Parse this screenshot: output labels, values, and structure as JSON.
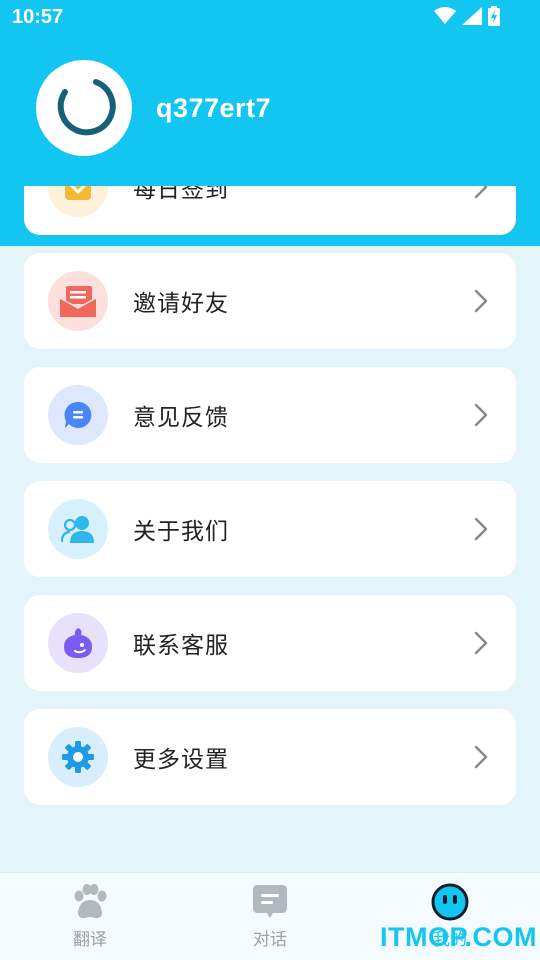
{
  "status_bar": {
    "time": "10:57",
    "icons": [
      "wifi-icon",
      "signal-icon",
      "battery-charging-icon"
    ]
  },
  "profile": {
    "username": "q377ert7",
    "avatar_icon": "loading-spinner-icon"
  },
  "menu": {
    "items": [
      {
        "label": "每日签到",
        "icon": "calendar-check-icon",
        "color": "#f8b733"
      },
      {
        "label": "邀请好友",
        "icon": "envelope-invite-icon",
        "color": "#f0685b"
      },
      {
        "label": "意见反馈",
        "icon": "chat-bubble-icon",
        "color": "#4a86f7"
      },
      {
        "label": "关于我们",
        "icon": "people-icon",
        "color": "#2fb6ea"
      },
      {
        "label": "联系客服",
        "icon": "customer-service-icon",
        "color": "#7b5cf0"
      },
      {
        "label": "更多设置",
        "icon": "gear-icon",
        "color": "#1d9ae8"
      }
    ]
  },
  "bottom_nav": {
    "tabs": [
      {
        "label": "翻译",
        "icon": "paw-icon",
        "active": false
      },
      {
        "label": "对话",
        "icon": "message-icon",
        "active": false
      },
      {
        "label": "我的",
        "icon": "mine-face-icon",
        "active": true
      }
    ]
  },
  "watermark": "ITMOP.COM",
  "colors": {
    "header": "#13c5f1",
    "background": "#e3f4fb",
    "accent": "#13c5f1"
  }
}
